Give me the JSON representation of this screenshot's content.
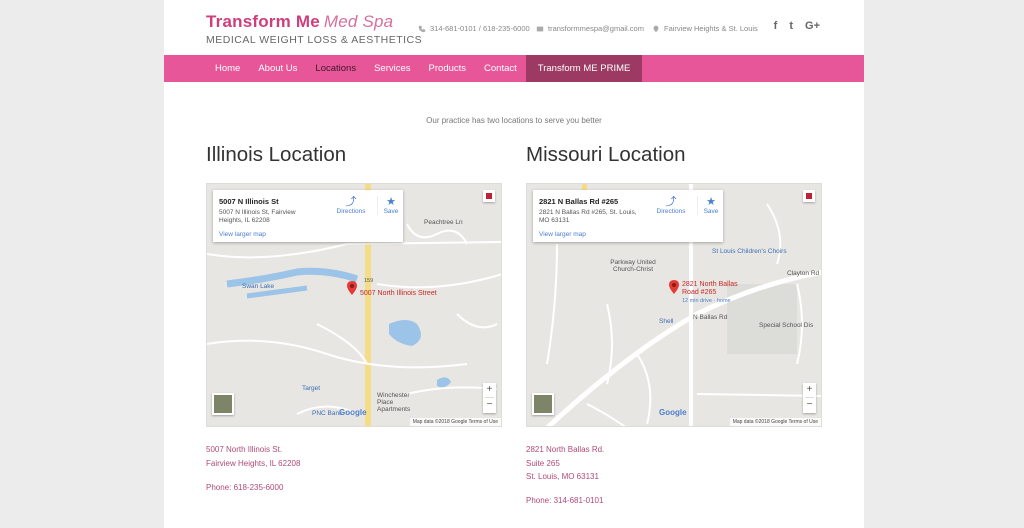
{
  "brand": {
    "name": "Transform Me",
    "name_italic": "Med Spa",
    "tagline": "MEDICAL WEIGHT LOSS & AESTHETICS"
  },
  "contact": {
    "phones": "314-681-0101 / 618-235-6000",
    "email": "transformmespa@gmail.com",
    "locations": "Fairview Heights & St. Louis"
  },
  "social": [
    {
      "icon": "facebook-icon",
      "glyph": "f"
    },
    {
      "icon": "twitter-icon",
      "glyph": "t"
    },
    {
      "icon": "google-plus-icon",
      "glyph": "G+"
    }
  ],
  "nav": [
    "Home",
    "About Us",
    "Locations",
    "Services",
    "Products",
    "Contact",
    "Transform ME PRIME"
  ],
  "nav_active": "Locations",
  "tagline": "Our practice has two locations to serve you better",
  "illinois": {
    "title": "Illinois Location",
    "card": {
      "name": "5007 N Illinois St",
      "address": "5007 N Illinois St, Fairview Heights, IL 62208",
      "directions": "Directions",
      "save": "Save",
      "larger": "View larger map"
    },
    "pin_label": "5007 North Illinois Street",
    "labels": {
      "swan": "Swan Lake",
      "target": "Target",
      "pnc": "PNC Bank",
      "winchester": "Winchester Place Apartments",
      "peachtree": "Peachtree Ln",
      "route": "159"
    },
    "attribution": "Map data ©2018 Google   Terms of Use",
    "address_lines": [
      "5007 North Illinois St.",
      "Fairview Heights, IL 62208"
    ],
    "phone": "Phone: 618-235-6000"
  },
  "missouri": {
    "title": "Missouri Location",
    "card": {
      "name": "2821 N Ballas Rd #265",
      "address": "2821 N Ballas Rd #265, St. Louis, MO 63131",
      "directions": "Directions",
      "save": "Save",
      "larger": "View larger map"
    },
    "pin_label": "2821 North Ballas Road #265",
    "pin_sub": "12 min drive · home",
    "labels": {
      "choirs": "St Louis Children's Choirs",
      "parkway": "Parkway United Church-Christ",
      "clayton": "Clayton Rd",
      "school": "Special School Dis",
      "shell": "Shell",
      "ballas": "N Ballas Rd"
    },
    "attribution": "Map data ©2018 Google   Terms of Use",
    "address_lines": [
      "2821 North Ballas Rd.",
      "Suite 265",
      "St. Louis, MO 63131"
    ],
    "phone": "Phone: 314-681-0101"
  },
  "map_zoom": {
    "plus": "+",
    "minus": "−"
  },
  "google": "Google",
  "colors": {
    "accent": "#e8569a",
    "prime": "#9c3a63",
    "brand": "#cf3e7c",
    "link": "#b04a78"
  }
}
